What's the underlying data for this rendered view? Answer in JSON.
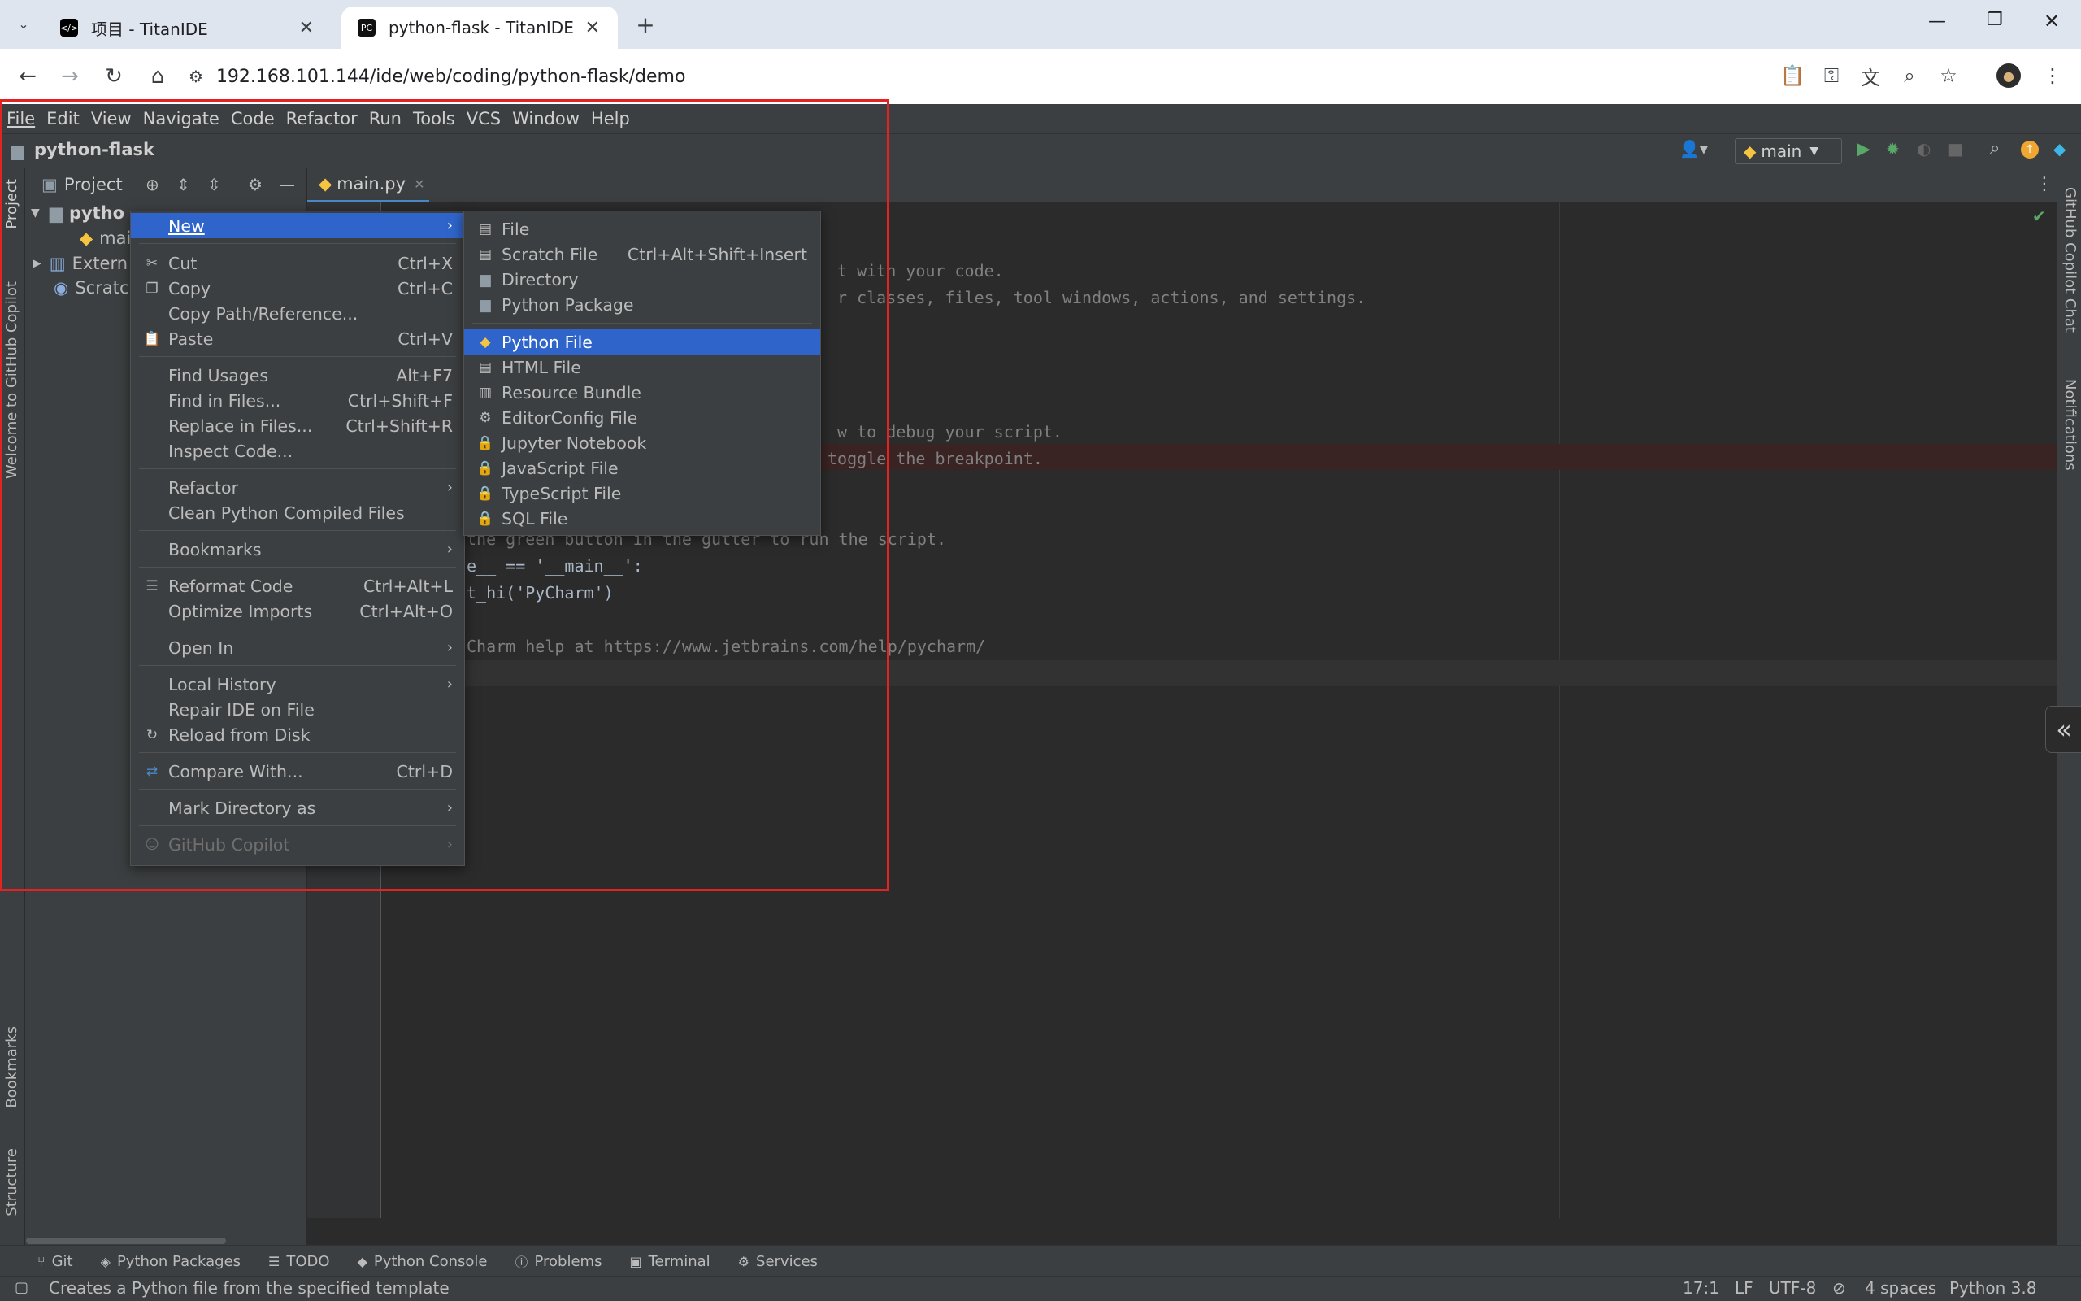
{
  "browser": {
    "tabs": [
      {
        "title": "项目 - TitanIDE",
        "active": false
      },
      {
        "title": "python-flask - TitanIDE",
        "active": true
      }
    ],
    "url": "192.168.101.144/ide/web/coding/python-flask/demo"
  },
  "menubar": [
    "File",
    "Edit",
    "View",
    "Navigate",
    "Code",
    "Refactor",
    "Run",
    "Tools",
    "VCS",
    "Window",
    "Help"
  ],
  "project": {
    "name": "python-flask",
    "panel_title": "Project",
    "branch": "main",
    "tree": [
      "pytho",
      "mai",
      "Extern",
      "Scratc"
    ]
  },
  "editor": {
    "tab": "main.py",
    "lines": [
      "t with your code.",
      "r classes, files, tool windows, actions, and settings.",
      "w to debug your script.",
      "toggle the breakpoint.",
      "the green button in the gutter to run the script.",
      "e__ == '__main__':",
      "t_hi('PyCharm')",
      "Charm help at https://www.jetbrains.com/help/pycharm/"
    ]
  },
  "context_menu": {
    "items": [
      {
        "label": "New",
        "shortcut": "",
        "submenu": true,
        "selected": true
      },
      {
        "label": "Cut",
        "shortcut": "Ctrl+X",
        "icon": "scissors-icon"
      },
      {
        "label": "Copy",
        "shortcut": "Ctrl+C",
        "icon": "copy-icon"
      },
      {
        "label": "Copy Path/Reference...",
        "shortcut": ""
      },
      {
        "label": "Paste",
        "shortcut": "Ctrl+V",
        "icon": "paste-icon"
      },
      {
        "label": "Find Usages",
        "shortcut": "Alt+F7"
      },
      {
        "label": "Find in Files...",
        "shortcut": "Ctrl+Shift+F"
      },
      {
        "label": "Replace in Files...",
        "shortcut": "Ctrl+Shift+R"
      },
      {
        "label": "Inspect Code...",
        "shortcut": ""
      },
      {
        "label": "Refactor",
        "submenu": true
      },
      {
        "label": "Clean Python Compiled Files",
        "shortcut": ""
      },
      {
        "label": "Bookmarks",
        "submenu": true
      },
      {
        "label": "Reformat Code",
        "shortcut": "Ctrl+Alt+L",
        "icon": "reformat-icon"
      },
      {
        "label": "Optimize Imports",
        "shortcut": "Ctrl+Alt+O"
      },
      {
        "label": "Open In",
        "submenu": true
      },
      {
        "label": "Local History",
        "submenu": true
      },
      {
        "label": "Repair IDE on File",
        "shortcut": ""
      },
      {
        "label": "Reload from Disk",
        "shortcut": "",
        "icon": "reload-icon"
      },
      {
        "label": "Compare With...",
        "shortcut": "Ctrl+D",
        "icon": "compare-icon"
      },
      {
        "label": "Mark Directory as",
        "submenu": true
      },
      {
        "label": "GitHub Copilot",
        "submenu": true,
        "disabled": true
      }
    ]
  },
  "new_submenu": {
    "items": [
      {
        "label": "File",
        "shortcut": ""
      },
      {
        "label": "Scratch File",
        "shortcut": "Ctrl+Alt+Shift+Insert"
      },
      {
        "label": "Directory",
        "shortcut": ""
      },
      {
        "label": "Python Package",
        "shortcut": ""
      },
      {
        "label": "Python File",
        "shortcut": "",
        "selected": true
      },
      {
        "label": "HTML File",
        "shortcut": ""
      },
      {
        "label": "Resource Bundle",
        "shortcut": ""
      },
      {
        "label": "EditorConfig File",
        "shortcut": ""
      },
      {
        "label": "Jupyter Notebook",
        "shortcut": ""
      },
      {
        "label": "JavaScript File",
        "shortcut": ""
      },
      {
        "label": "TypeScript File",
        "shortcut": ""
      },
      {
        "label": "SQL File",
        "shortcut": ""
      }
    ]
  },
  "bottom_tools": [
    "Git",
    "Python Packages",
    "TODO",
    "Python Console",
    "Problems",
    "Terminal",
    "Services"
  ],
  "side_tools": {
    "left": [
      "Project",
      "Welcome to GitHub Copilot",
      "Bookmarks",
      "Structure"
    ],
    "right": [
      "GitHub Copilot Chat",
      "Notifications"
    ]
  },
  "statusbar": {
    "message": "Creates a Python file from the specified template",
    "position": "17:1",
    "line_sep": "LF",
    "encoding": "UTF-8",
    "indent": "4 spaces",
    "interpreter": "Python 3.8"
  },
  "colors": {
    "selection": "#2f65ca",
    "highlight_box": "#e52222",
    "ide_bg": "#2b2b2b",
    "panel_bg": "#3c3f41"
  }
}
